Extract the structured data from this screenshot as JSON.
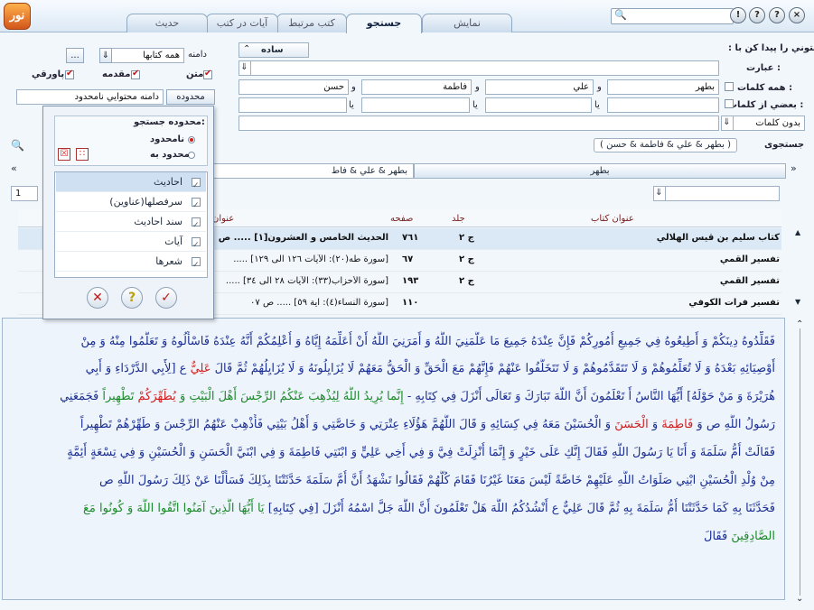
{
  "app": {
    "logo_text": "نور"
  },
  "tabs": [
    {
      "label": "نمايش"
    },
    {
      "label": "جستجو"
    },
    {
      "label": "كتب مرتبط"
    },
    {
      "label": "آيات در كتب"
    },
    {
      "label": "حديث"
    }
  ],
  "window": {
    "help": "?",
    "info": "!",
    "options": "?",
    "close": "×"
  },
  "scope": {
    "label": "دامنه",
    "value": "همه كتابها",
    "more": "...",
    "text_label": "متن",
    "intro_label": "مقدمه",
    "footnote_label": "پاورقي",
    "range_button": "محدوده جستجو",
    "range_field": "دامنه محتوايي نامحدود"
  },
  "query": {
    "find_label": "متوني را پيدا كن با :",
    "mode": "ساده",
    "phrase_label": "عبارت :",
    "phrase_value": "",
    "all_words_label": "همه كلمات :",
    "w1": "بطهر",
    "w2": "علي",
    "w3": "فاطمة",
    "w4": "حسن",
    "and": "و",
    "some_words_label": "بعضي از كلمات :",
    "or": "يا",
    "without_label": "بدون كلمات"
  },
  "search_label": "جستجوی",
  "search_expr": "( بطهر & علي & فاطمة & حسن )",
  "subtabs": [
    {
      "label": "بطهر"
    },
    {
      "label": "بطهر & علي & فاط"
    }
  ],
  "page_number": "1",
  "popup": {
    "group_label": "محدوده جستجو:",
    "opt_unlimited": "نامحدود",
    "opt_limited": "محدود به",
    "items": [
      {
        "label": "احاديث"
      },
      {
        "label": "سرفصلها(عناوين)"
      },
      {
        "label": "سند احاديث"
      },
      {
        "label": "آيات"
      },
      {
        "label": "شعرها"
      }
    ],
    "btn_cancel": "✕",
    "btn_help": "?",
    "btn_ok": "✓"
  },
  "table": {
    "headers": {
      "book": "عنوان كتاب",
      "vol": "جلد",
      "page": "صفحه",
      "title": "عنوان"
    },
    "rows": [
      {
        "book": "كتاب سليم بن قيس الهلالي",
        "vol": "ج ٢",
        "page": "٧٦١",
        "title": "الحديث الخامس و العشرون[١] ..... ص"
      },
      {
        "book": "تفسير القمي",
        "vol": "ج ٢",
        "page": "٦٧",
        "title": "[سورة طه(٢٠): الآيات ١٢٦ الى ١٢٩] ....."
      },
      {
        "book": "تفسير القمي",
        "vol": "ج ٢",
        "page": "١٩٣",
        "title": "[سورة الأحزاب(٣٣): الآيات ٢٨ الى ٣٤] ....."
      },
      {
        "book": "تفسير فرات الكوفي",
        "vol": "",
        "page": "١١٠",
        "title": "[سورة النساء(٤): آية ٥٩] ..... ص ٠٧"
      }
    ]
  },
  "text": {
    "l1": "فَقَلِّدُوهُ دِينَكُمْ وَ أَطِيعُوهُ فِي جَمِيعِ أُمُورِكُمْ فَإِنَّ عِنْدَهُ جَمِيعَ مَا عَلَّمَنِيَ اللَّهُ وَ أَمَرَنِيَ اللَّهُ أَنْ أُعَلِّمَهُ إِيَّاهُ وَ أُعْلِمُكُمْ أَنَّهُ عِنْدَهُ فَاسْأَلُوهُ وَ تَعَلَّمُوا مِنْهُ وَ مِنْ",
    "l2": "أَوْصِيَائِهِ بَعْدَهُ وَ لَا تُعَلِّمُوهُمْ وَ لَا تَتَقَدَّمُوهُمْ وَ لَا تَتَخَلَّفُوا عَنْهُمْ فَإِنَّهُمْ مَعَ الْحَقِّ وَ الْحَقُّ مَعَهُمْ لَا يُزَايِلُونَهُ وَ لَا يُزَايِلُهُمْ ثُمَّ قَالَ",
    "l2_red": "عَلِيٌّ",
    "l2_end": "ع [لِأَبِي الدَّرْدَاءِ وَ أَبِي",
    "l3": "هُرَيْرَةَ وَ مَنْ حَوْلَهُ] أَيُّهَا النَّاسُ أَ تَعْلَمُونَ أَنَّ اللَّهَ تَبَارَكَ وَ تَعَالَى أَنْزَلَ فِي كِتَابِهِ -",
    "l3_green": "إِنَّما يُرِيدُ اللَّهُ لِيُذْهِبَ عَنْكُمُ الرِّجْسَ أَهْلَ الْبَيْتِ وَ",
    "l3_red": "يُطَهِّرَكُمْ",
    "l3_green2": "تَطْهِيراً",
    "l3_end": "فَجَمَعَنِي",
    "l4": "رَسُولُ اللَّهِ ص وَ",
    "l4_red1": "فَاطِمَةَ",
    "l4_mid": "وَ",
    "l4_red2": "الْحَسَنَ",
    "l4_end": "وَ الْحُسَيْنَ مَعَهُ فِي كِسَائِهِ وَ قَالَ اللَّهُمَّ هَؤُلَاءِ عِتْرَتِي وَ خَاصَّتِي وَ أَهْلُ بَيْتِي فَأَذْهِبْ عَنْهُمُ الرِّجْسَ وَ طَهِّرْهُمْ تَطْهِيراً",
    "l5": "فَقَالَتْ أُمُّ سَلَمَةَ وَ أَنَا يَا رَسُولَ اللَّهِ فَقَالَ إِنَّكِ عَلَى خَيْرٍ وَ إِنَّمَا أُنْزِلَتْ فِيَّ وَ فِي أَخِي عَلِيٍّ وَ ابْنَتِي فَاطِمَةَ وَ فِي ابْنَيَّ الْحَسَنِ وَ الْحُسَيْنِ وَ فِي تِسْعَةٍ أَئِمَّةٍ",
    "l6": "مِنْ وُلْدِ الْحُسَيْنِ ابْنِي صَلَوَاتُ اللَّهِ عَلَيْهِمْ خَاصَّةً لَيْسَ مَعَنَا غَيْرُنَا فَقَامَ كُلُّهُمْ فَقَالُوا نَشْهَدُ أَنَّ أُمَّ سَلَمَةَ حَدَّثَتْنَا بِذَلِكَ فَسَأَلْنَا عَنْ ذَلِكَ رَسُولَ اللَّهِ ص",
    "l7": "فَحَدَّثَنَا بِهِ كَمَا حَدَّثَتْنَا أُمُّ سَلَمَةَ بِهِ ثُمَّ قَالَ عَلِيٌّ ع أَنْشُدُكُمُ اللَّهَ هَلْ تَعْلَمُونَ أَنَّ اللَّهَ جَلَّ اسْمُهُ أَنْزَلَ [فِي كِتَابِهِ]",
    "l7_green": "يَا أَيُّهَا الَّذِينَ آمَنُوا اتَّقُوا اللَّهَ وَ كُونُوا مَعَ",
    "l8_green": "الصَّادِقِينَ",
    "l8_end": "فَقَالَ"
  }
}
